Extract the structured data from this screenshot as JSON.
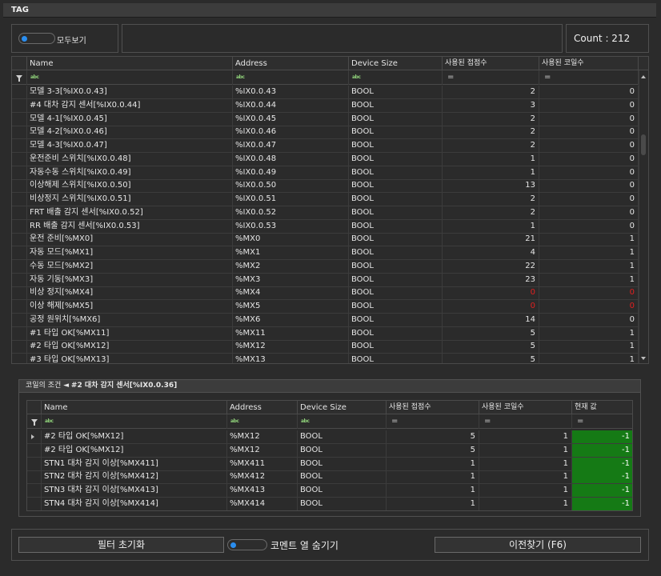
{
  "window": {
    "title": "TAG"
  },
  "top_bar": {
    "show_all_label": "모두보기",
    "count_label": "Count : 212"
  },
  "main_grid": {
    "columns": [
      "Name",
      "Address",
      "Device Size",
      "사용된 접점수",
      "사용된 코일수"
    ],
    "filters": [
      "abc",
      "abc",
      "abc",
      "=",
      "="
    ],
    "rows": [
      [
        "모델 3-3[%IX0.0.43]",
        "%IX0.0.43",
        "BOOL",
        "2",
        "0"
      ],
      [
        "#4 대차 감지 센서[%IX0.0.44]",
        "%IX0.0.44",
        "BOOL",
        "3",
        "0"
      ],
      [
        "모델 4-1[%IX0.0.45]",
        "%IX0.0.45",
        "BOOL",
        "2",
        "0"
      ],
      [
        "모델 4-2[%IX0.0.46]",
        "%IX0.0.46",
        "BOOL",
        "2",
        "0"
      ],
      [
        "모델 4-3[%IX0.0.47]",
        "%IX0.0.47",
        "BOOL",
        "2",
        "0"
      ],
      [
        "운전준비   스위치[%IX0.0.48]",
        "%IX0.0.48",
        "BOOL",
        "1",
        "0"
      ],
      [
        "자동수동   스위치[%IX0.0.49]",
        "%IX0.0.49",
        "BOOL",
        "1",
        "0"
      ],
      [
        "이상해제   스위치[%IX0.0.50]",
        "%IX0.0.50",
        "BOOL",
        "13",
        "0"
      ],
      [
        "비상정지   스위치[%IX0.0.51]",
        "%IX0.0.51",
        "BOOL",
        "2",
        "0"
      ],
      [
        "FRT 배출 감지 센서[%IX0.0.52]",
        "%IX0.0.52",
        "BOOL",
        "2",
        "0"
      ],
      [
        "RR 배출 감지 센서[%IX0.0.53]",
        "%IX0.0.53",
        "BOOL",
        "1",
        "0"
      ],
      [
        "운전 준비[%MX0]",
        "%MX0",
        "BOOL",
        "21",
        "1"
      ],
      [
        "자동 모드[%MX1]",
        "%MX1",
        "BOOL",
        "4",
        "1"
      ],
      [
        "수동 모드[%MX2]",
        "%MX2",
        "BOOL",
        "22",
        "1"
      ],
      [
        "자동 기동[%MX3]",
        "%MX3",
        "BOOL",
        "23",
        "1"
      ],
      [
        "비상 정지[%MX4]",
        "%MX4",
        "BOOL",
        "0",
        "0"
      ],
      [
        "이상 해제[%MX5]",
        "%MX5",
        "BOOL",
        "0",
        "0"
      ],
      [
        "공정 원위치[%MX6]",
        "%MX6",
        "BOOL",
        "14",
        "0"
      ],
      [
        "#1 타입 OK[%MX11]",
        "%MX11",
        "BOOL",
        "5",
        "1"
      ],
      [
        "#2 타입 OK[%MX12]",
        "%MX12",
        "BOOL",
        "5",
        "1"
      ],
      [
        "#3 타입 OK[%MX13]",
        "%MX13",
        "BOOL",
        "5",
        "1"
      ]
    ]
  },
  "coil_panel": {
    "title_prefix": "코일의 조건 ◄ ",
    "title_tag": "#2 대차 감지 센서[%IX0.0.36]",
    "columns": [
      "Name",
      "Address",
      "Device Size",
      "사용된 접점수",
      "사용된 코일수",
      "현재 값"
    ],
    "filters": [
      "abc",
      "abc",
      "abc",
      "=",
      "=",
      "="
    ],
    "rows": [
      [
        "#2 타입 OK[%MX12]",
        "%MX12",
        "BOOL",
        "5",
        "1",
        "-1"
      ],
      [
        "#2 타입 OK[%MX12]",
        "%MX12",
        "BOOL",
        "5",
        "1",
        "-1"
      ],
      [
        "STN1 대차 감지 이상[%MX411]",
        "%MX411",
        "BOOL",
        "1",
        "1",
        "-1"
      ],
      [
        "STN2 대차 감지 이상[%MX412]",
        "%MX412",
        "BOOL",
        "1",
        "1",
        "-1"
      ],
      [
        "STN3 대차 감지 이상[%MX413]",
        "%MX413",
        "BOOL",
        "1",
        "1",
        "-1"
      ],
      [
        "STN4 대차 감지 이상[%MX414]",
        "%MX414",
        "BOOL",
        "1",
        "1",
        "-1"
      ]
    ]
  },
  "footer": {
    "reset_filter_label": "필터 초기화",
    "hide_comment_label": "코멘트 열 숨기기",
    "find_prev_label": "이전찾기 (F6)"
  },
  "colors": {
    "accent": "#2a8ef0",
    "value_highlight": "#157a15",
    "zero_alert": "#e02020"
  }
}
